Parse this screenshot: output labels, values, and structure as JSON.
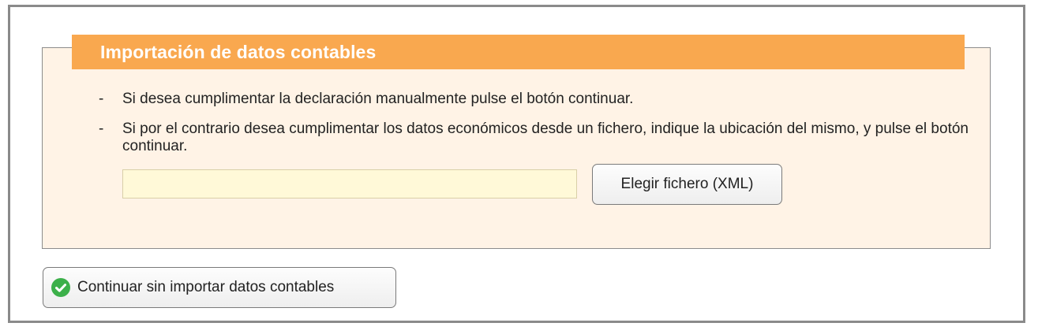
{
  "panel": {
    "title": "Importación de datos contables",
    "instructions": [
      {
        "bullet": "-",
        "text": "Si desea cumplimentar la declaración manualmente pulse el botón continuar."
      },
      {
        "bullet": "-",
        "text": "Si por el contrario desea cumplimentar los datos económicos desde un fichero, indique la ubicación del mismo, y pulse el botón continuar."
      }
    ],
    "file_input": {
      "value": "",
      "placeholder": ""
    },
    "choose_file_label": "Elegir fichero (XML)"
  },
  "footer": {
    "continue_label": "Continuar sin importar datos contables",
    "continue_icon": "check-circle-icon"
  },
  "colors": {
    "header_bg": "#f9a84f",
    "panel_bg": "#fff3e6",
    "input_bg": "#fff9d8",
    "check_green": "#3cb04a"
  }
}
